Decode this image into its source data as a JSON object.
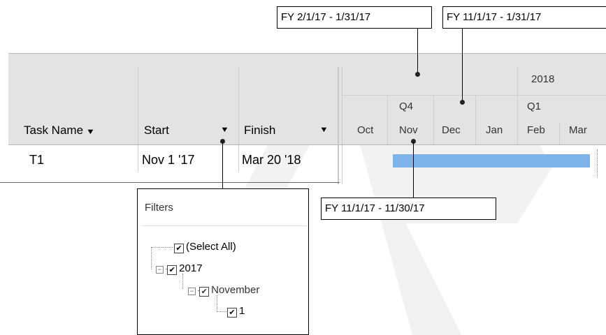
{
  "callouts": {
    "top_left": "FY 2/1/17 - 1/31/17",
    "top_right": "FY 11/1/17 - 1/31/17",
    "middle": "FY 11/1/17 - 11/30/17"
  },
  "columns": {
    "task_name": "Task Name",
    "start": "Start",
    "finish": "Finish"
  },
  "timeline": {
    "year": "2018",
    "quarters": [
      "Q4",
      "Q1"
    ],
    "months": [
      "Oct",
      "Nov",
      "Dec",
      "Jan",
      "Feb",
      "Mar"
    ]
  },
  "row": {
    "task": "T1",
    "start": "Nov 1 '17",
    "finish": "Mar 20 '18"
  },
  "filters": {
    "title": "Filters",
    "select_all": "(Select All)",
    "year": "2017",
    "month": "November",
    "day": "1"
  },
  "colors": {
    "header_bg": "#e3e3e3",
    "bar": "#7eb3ea"
  }
}
